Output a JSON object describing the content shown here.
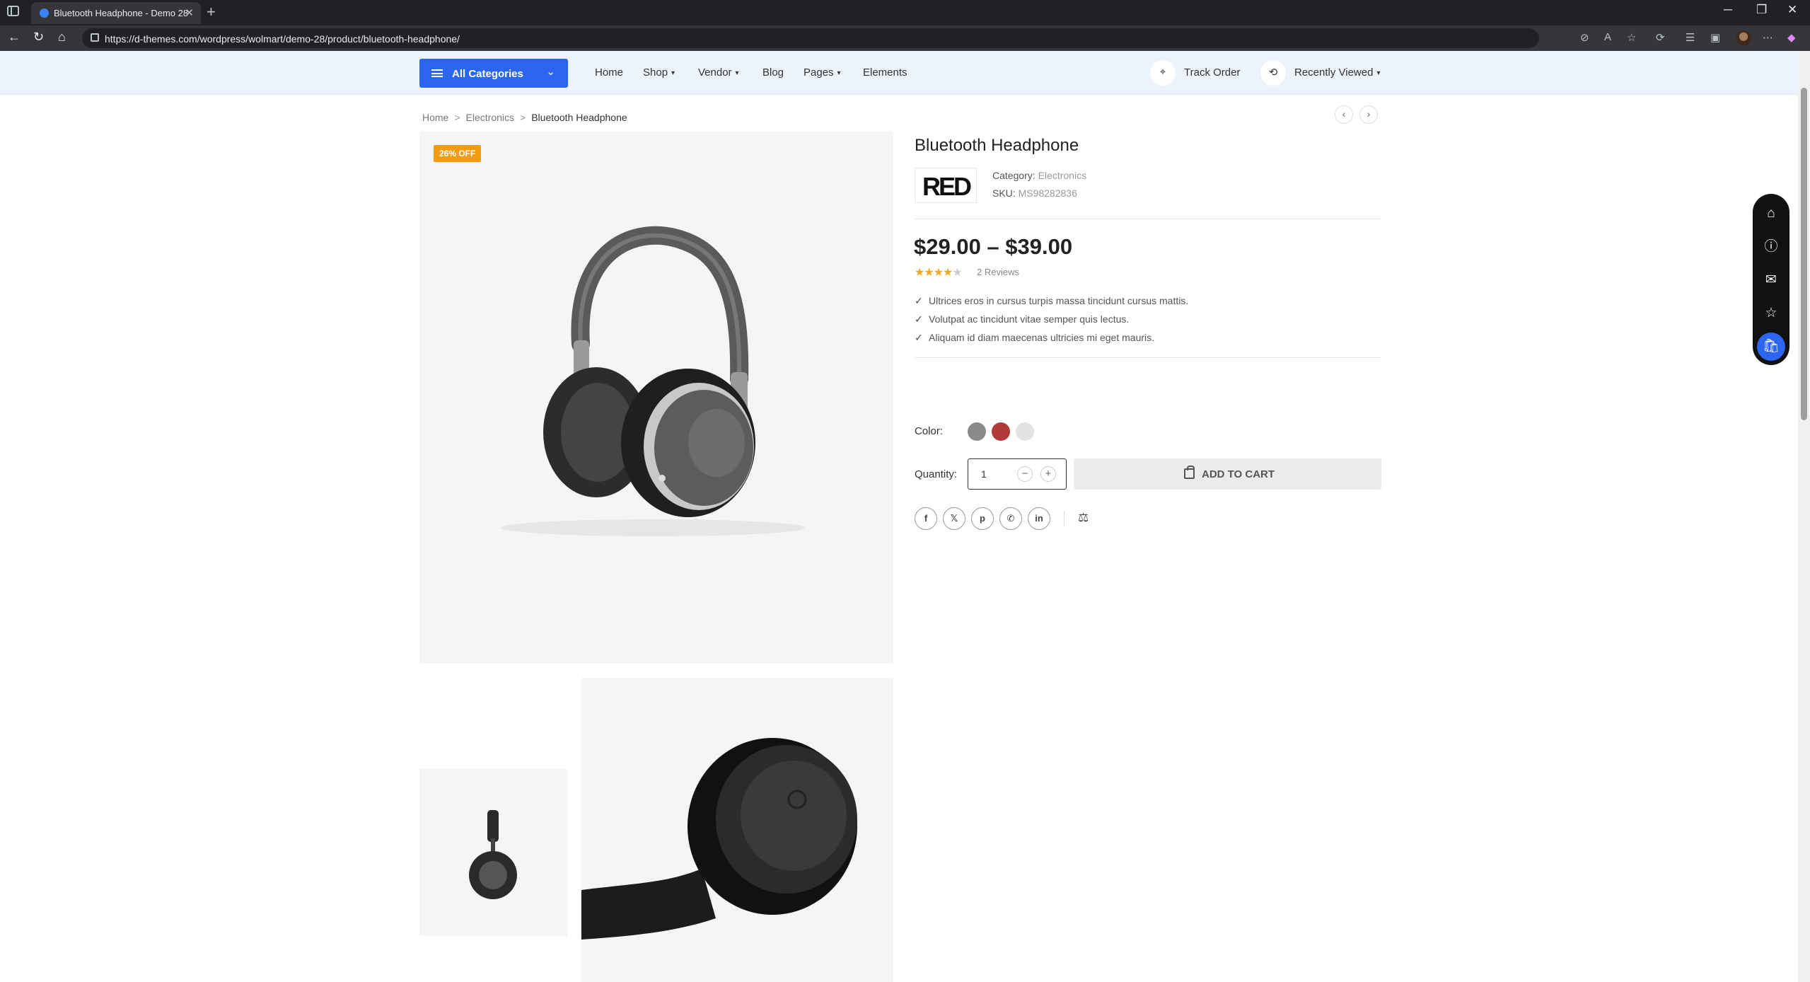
{
  "browser": {
    "tab_title": "Bluetooth Headphone - Demo 28",
    "url": "https://d-themes.com/wordpress/wolmart/demo-28/product/bluetooth-headphone/"
  },
  "nav": {
    "categories_label": "All Categories",
    "menu": [
      {
        "label": "Home",
        "dropdown": false
      },
      {
        "label": "Shop",
        "dropdown": true
      },
      {
        "label": "Vendor",
        "dropdown": true
      },
      {
        "label": "Blog",
        "dropdown": false
      },
      {
        "label": "Pages",
        "dropdown": true
      },
      {
        "label": "Elements",
        "dropdown": false
      }
    ],
    "track_order": "Track Order",
    "recently_viewed": "Recently Viewed"
  },
  "breadcrumb": [
    "Home",
    "Electronics",
    "Bluetooth Headphone"
  ],
  "product": {
    "badge": "26% OFF",
    "title": "Bluetooth Headphone",
    "brand": "RED",
    "category_label": "Category:",
    "category": "Electronics",
    "sku_label": "SKU:",
    "sku": "MS98282836",
    "price": "$29.00 – $39.00",
    "rating": 4,
    "rating_max": 5,
    "reviews": "2 Reviews",
    "features": [
      "Ultrices eros in cursus turpis massa tincidunt cursus mattis.",
      "Volutpat ac tincidunt vitae semper quis lectus.",
      "Aliquam id diam maecenas ultricies mi eget mauris."
    ],
    "color_label": "Color:",
    "colors": [
      "#8a8a8a",
      "#b03a3a",
      "#e2e2e2"
    ],
    "quantity_label": "Quantity:",
    "quantity": "1",
    "add_to_cart": "ADD TO CART"
  },
  "share": [
    "facebook-icon",
    "x-icon",
    "pinterest-icon",
    "whatsapp-icon",
    "linkedin-icon"
  ],
  "colors": {
    "accent": "#2c66f0",
    "badge": "#f39c12",
    "nav_bg": "#edf3fd"
  }
}
